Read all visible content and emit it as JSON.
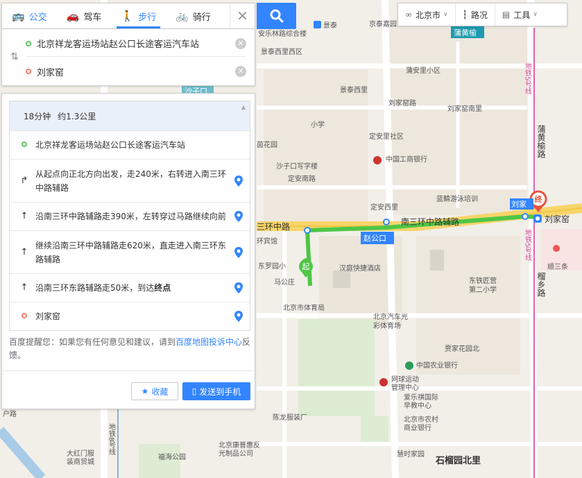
{
  "modes": [
    {
      "label": "公交",
      "icon": "bus-icon"
    },
    {
      "label": "驾车",
      "icon": "car-icon"
    },
    {
      "label": "步行",
      "icon": "walk-icon"
    },
    {
      "label": "骑行",
      "icon": "bike-icon"
    }
  ],
  "active_mode": "步行",
  "route": {
    "from": "北京祥龙客运场站赵公口长途客运汽车站",
    "to": "刘家窑"
  },
  "summary": {
    "time": "18分钟",
    "distance": "约1.3公里"
  },
  "steps": {
    "start": "北京祥龙客运场站赵公口长途客运汽车站",
    "s1": "从起点向正北方向出发，走240米，右转进入南三环中路辅路",
    "s2": "沿南三环中路辅路走390米，左转穿过马路继续向前",
    "s3": "继续沿南三环中路辅路走620米，直走进入南三环东路辅路",
    "s4_prefix": "沿南三环东路辅路走50米，到达",
    "s4_bold": "终点",
    "end": "刘家窑"
  },
  "tip": {
    "prefix": "百度提醒您：如果您有任何意见和建议，请到",
    "link": "百度地图投诉中心",
    "suffix": "反馈。"
  },
  "buttons": {
    "favorite": "收藏",
    "send": "发送到手机"
  },
  "toolbar": {
    "city": "北京市",
    "traffic": "路况",
    "tools": "工具"
  },
  "map_labels": {
    "jingtai": "景泰",
    "jingtai_v": "京泰嘉园",
    "anlexiyuan": "安乐林路综合楼",
    "jingtaixili": "景泰西里西区",
    "puhuangyu": "蒲黄榆",
    "puanli": "蒲安里小区",
    "jingtaixili2": "景泰西里",
    "shaziko": "沙子口",
    "liujiayaolu": "刘家窑路",
    "liujiayaonanli": "刘家窑南里",
    "xiaoxue": "小学",
    "dinganxili": "定安里社区",
    "puhuangyu_v": "蒲黄榆路",
    "icbc": "中国工商银行",
    "shazikou_office": "沙子口写字楼",
    "yinghuayuan": "茵花园",
    "dinganli": "定安南路",
    "lanjingyouyong": "蓝鲭游泳培训",
    "dinganxili2": "定安西里",
    "liujia": "刘家",
    "nansanhuan": "三环中路",
    "nansanhuanfulu": "南三环中路辅路",
    "liujiayao_station": "刘家窑",
    "zhaogongkou": "赵公口",
    "huanbinguan": "环宾馆",
    "dongluoyuan": "东罗园小",
    "hantingjiudian": "汉庭快捷酒店",
    "magonzhuang": "马公庄",
    "dongtiehuying": "东铁匠营",
    "dier": "第二小学",
    "beijingshitiyuguan": "北京市体育局",
    "qiche": "北京汽车光",
    "qiche2": "彩体育场",
    "liuxiang": "榴乡路",
    "jiayuanbei": "贾家花园北",
    "nongyebank": "中国农业银行",
    "wangqiu": "网球运动",
    "wangqiu2": "管理中心",
    "aileqi": "爱乐祺国际",
    "aileqi2": "早教中心",
    "nongshang": "北京市农村",
    "nongshang2": "商业银行",
    "chenlong": "陈龙服装厂",
    "dahongmen": "大红门服",
    "dahongmen2": "装商贸城",
    "kangpu": "北京康普惠反",
    "kangpu2": "光制品公司",
    "fuhai": "福海公园",
    "huishi": "慧时家园",
    "shiliuyuan": "石榴园北里",
    "shunsan": "顺三条",
    "metro5": "地铁5号线",
    "metro8": "地铁8号线",
    "metro5b": "地铁5号线",
    "shun": "户路"
  },
  "badges": {
    "start": "起",
    "end": "终"
  }
}
